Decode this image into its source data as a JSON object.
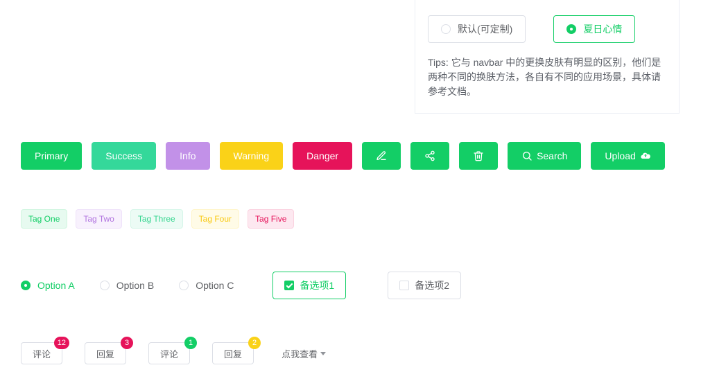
{
  "theme": {
    "default_label": "默认(可定制)",
    "summer_label": "夏日心情",
    "tips": "Tips: 它与 navbar 中的更换皮肤有明显的区别，他们是两种不同的换肤方法，各自有不同的应用场景，具体请参考文档。"
  },
  "buttons": {
    "primary": "Primary",
    "success": "Success",
    "info": "Info",
    "warning": "Warning",
    "danger": "Danger",
    "search": "Search",
    "upload": "Upload"
  },
  "tags": {
    "one": "Tag One",
    "two": "Tag Two",
    "three": "Tag Three",
    "four": "Tag Four",
    "five": "Tag Five"
  },
  "options": {
    "a": "Option A",
    "b": "Option B",
    "c": "Option C",
    "check1": "备选项1",
    "check2": "备选项2"
  },
  "badges": {
    "comment": "评论",
    "reply": "回复",
    "count1": "12",
    "count2": "3",
    "count3": "1",
    "count4": "2",
    "dropdown": "点我查看"
  }
}
